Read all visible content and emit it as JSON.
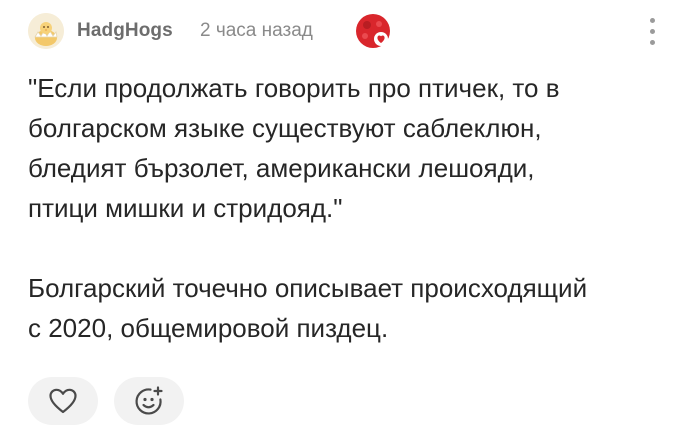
{
  "comment": {
    "author": "HadgHogs",
    "timestamp": "2 часа назад",
    "paragraphs": [
      "\"Если продолжать говорить про птичек, то в\nболгарском языке существуют саблеклюн,\nбледият бързолет, американски лешояди,\nптици мишки и стридояд.\"",
      "Болгарский точечно описывает происходящий\nс 2020, общемировой пиздец."
    ]
  },
  "icons": {
    "avatar": "chick-avatar",
    "badge": "heart-badge-icon",
    "menu": "more-vertical-icon",
    "like": "heart-outline-icon",
    "react": "add-emoji-icon"
  },
  "colors": {
    "badge_red": "#d9262c",
    "button_bg": "#f2f2f2",
    "icon_stroke": "#4a4a4a"
  }
}
